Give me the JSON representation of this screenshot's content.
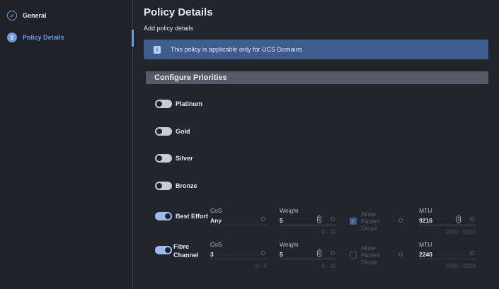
{
  "sidebar": {
    "steps": [
      {
        "label": "General",
        "status": "complete"
      },
      {
        "label": "Policy Details",
        "number": "2",
        "status": "active"
      }
    ]
  },
  "header": {
    "title": "Policy Details",
    "subtitle": "Add policy details"
  },
  "banner": {
    "text": "This policy is applicable only for UCS Domains",
    "icon": "info-icon"
  },
  "section": {
    "title": "Configure Priorities"
  },
  "priorities": [
    {
      "label": "Platinum",
      "enabled": false
    },
    {
      "label": "Gold",
      "enabled": false
    },
    {
      "label": "Silver",
      "enabled": false
    },
    {
      "label": "Bronze",
      "enabled": false
    },
    {
      "label": "Best Effort",
      "enabled": true,
      "cos_label": "CoS",
      "cos": "Any",
      "weight_label": "Weight",
      "weight": "5",
      "weight_range": "0 - 10",
      "allow_label": "Allow Packet Drops",
      "allow": true,
      "mtu_label": "MTU",
      "mtu": "9216",
      "mtu_range": "1500 - 9216"
    },
    {
      "label": "Fibre Channel",
      "label_l1": "Fibre",
      "label_l2": "Channel",
      "enabled": true,
      "cos_label": "CoS",
      "cos": "3",
      "cos_range": "0 - 6",
      "weight_label": "Weight",
      "weight": "5",
      "weight_range": "0 - 10",
      "allow_label": "Allow Packet Drops",
      "allow": false,
      "mtu_label": "MTU",
      "mtu": "2240",
      "mtu_range": "1500 - 9216"
    }
  ],
  "allow_words": [
    "Allow",
    "Packet",
    "Drops"
  ],
  "colors": {
    "accent": "#6b9be8",
    "banner": "#3e5d8c",
    "toggle_on": "#9cbcf0",
    "background": "#22252b"
  }
}
